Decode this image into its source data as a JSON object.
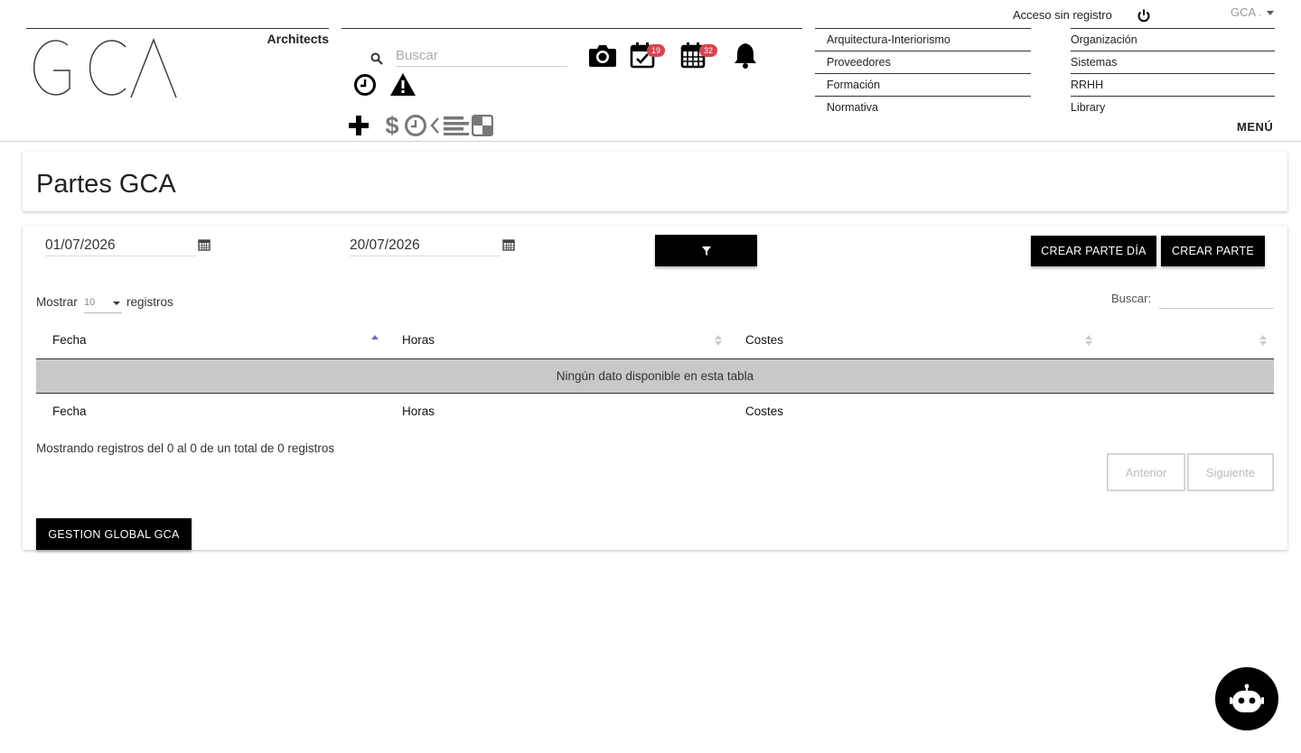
{
  "header": {
    "logo_text": "GCA",
    "logo_sub": "Architects",
    "search_placeholder": "Buscar",
    "badges": {
      "tasks": "19",
      "calendar": "32"
    },
    "access_text": "Acceso sin registro",
    "user_dropdown": "GCA .",
    "menu_label": "MENÚ",
    "menu_left": [
      "Arquitectura-Interiorismo",
      "Proveedores",
      "Formación",
      "Normativa"
    ],
    "menu_right": [
      "Organización",
      "Sistemas",
      "RRHH",
      "Library"
    ],
    "icons": [
      "search-icon",
      "camera-icon",
      "calendar-check-icon",
      "calendar-icon",
      "bell-icon",
      "clock-icon",
      "warning-icon",
      "plus-icon",
      "dollar-icon",
      "history-icon",
      "chevron-left-icon",
      "list-icon",
      "contrast-icon",
      "power-icon"
    ]
  },
  "page": {
    "title": "Partes GCA"
  },
  "filters": {
    "date_from": "01/07/2026",
    "date_to": "20/07/2026",
    "filter_icon": "filter-icon",
    "create_day_label": "CREAR PARTE DÍA",
    "create_label": "CREAR PARTE"
  },
  "table": {
    "show_prefix": "Mostrar",
    "page_length": "10",
    "show_suffix": "registros",
    "search_label": "Buscar:",
    "columns": [
      "Fecha",
      "Horas",
      "Costes",
      ""
    ],
    "empty_message": "Ningún dato disponible en esta tabla",
    "footer_columns": [
      "Fecha",
      "Horas",
      "Costes",
      ""
    ],
    "info": "Mostrando registros del 0 al 0 de un total de 0 registros",
    "prev_label": "Anterior",
    "next_label": "Siguiente"
  },
  "actions": {
    "global_label": "GESTION GLOBAL GCA"
  },
  "colors": {
    "badge": "#d9434e",
    "primary": "#000000",
    "empty_row": "#c8c8c8"
  }
}
